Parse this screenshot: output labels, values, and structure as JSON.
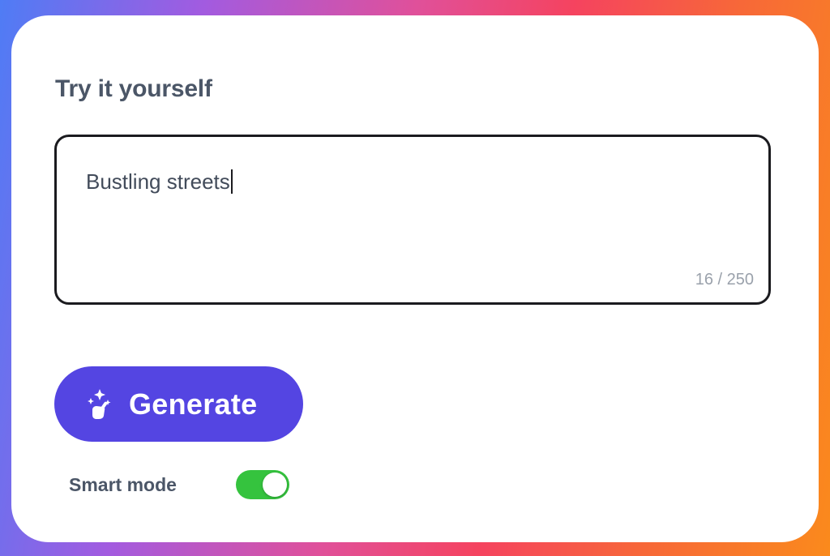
{
  "card": {
    "title": "Try it yourself"
  },
  "prompt_input": {
    "value": "Bustling streets",
    "counter": "16 / 250"
  },
  "generate_button": {
    "label": "Generate",
    "icon": "magic-wand-icon"
  },
  "smart_mode": {
    "label": "Smart mode",
    "enabled": true
  },
  "colors": {
    "button": "#5445e2",
    "toggle_on": "#35c33e",
    "text": "#4b5667",
    "counter": "#9aa1ab"
  }
}
